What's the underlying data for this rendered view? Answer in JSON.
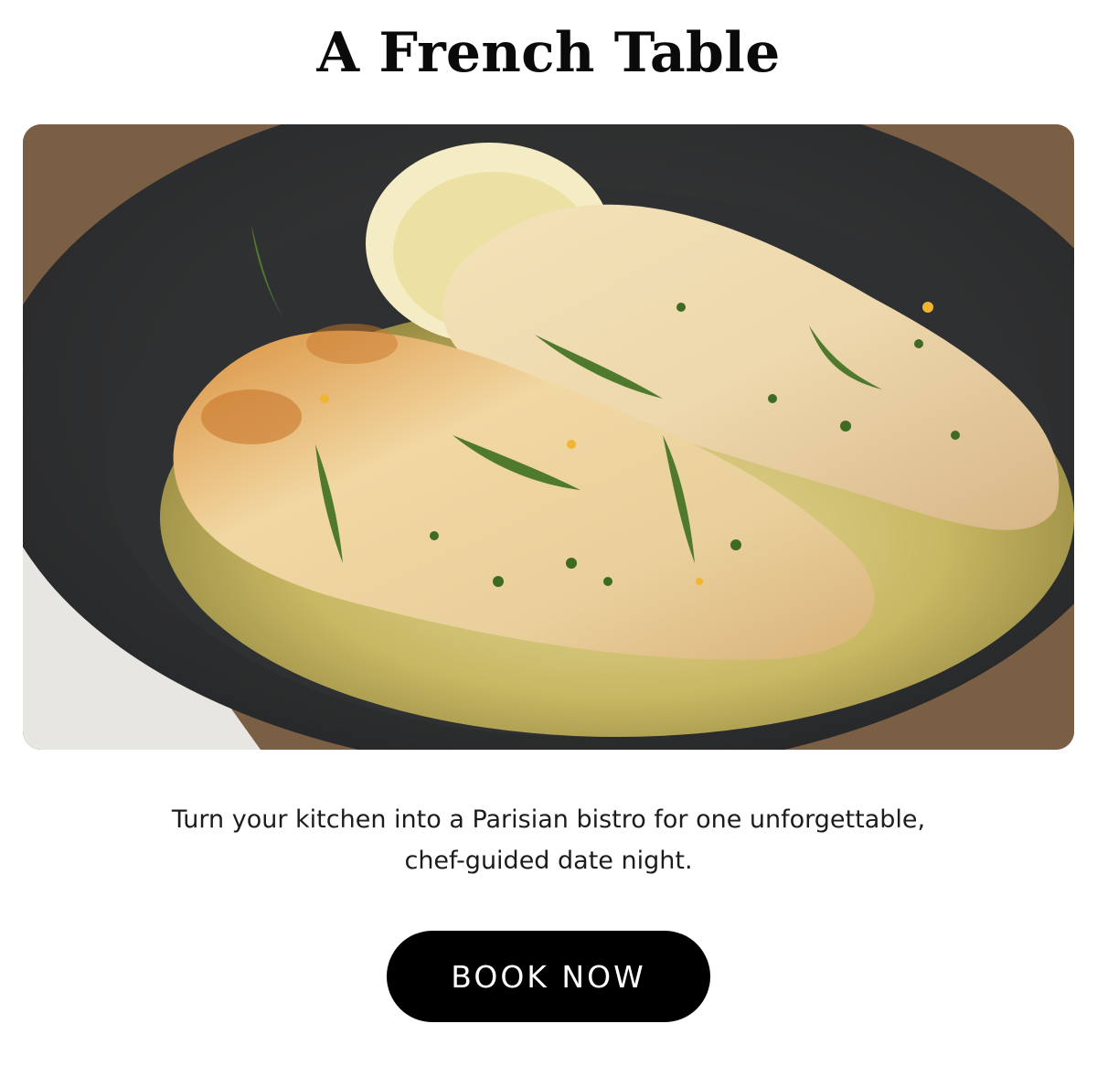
{
  "header": {
    "title": "A French Table"
  },
  "hero": {
    "description_icon": "pan-seared-fish-in-skillet-photo"
  },
  "body": {
    "description_line1": "Turn your kitchen into a Parisian bistro for one unforgettable,",
    "description_line2": "chef-guided date night."
  },
  "cta": {
    "label": "BOOK NOW"
  },
  "colors": {
    "background": "#ffffff",
    "button_bg": "#000000",
    "button_text": "#ffffff",
    "text": "#111111"
  }
}
